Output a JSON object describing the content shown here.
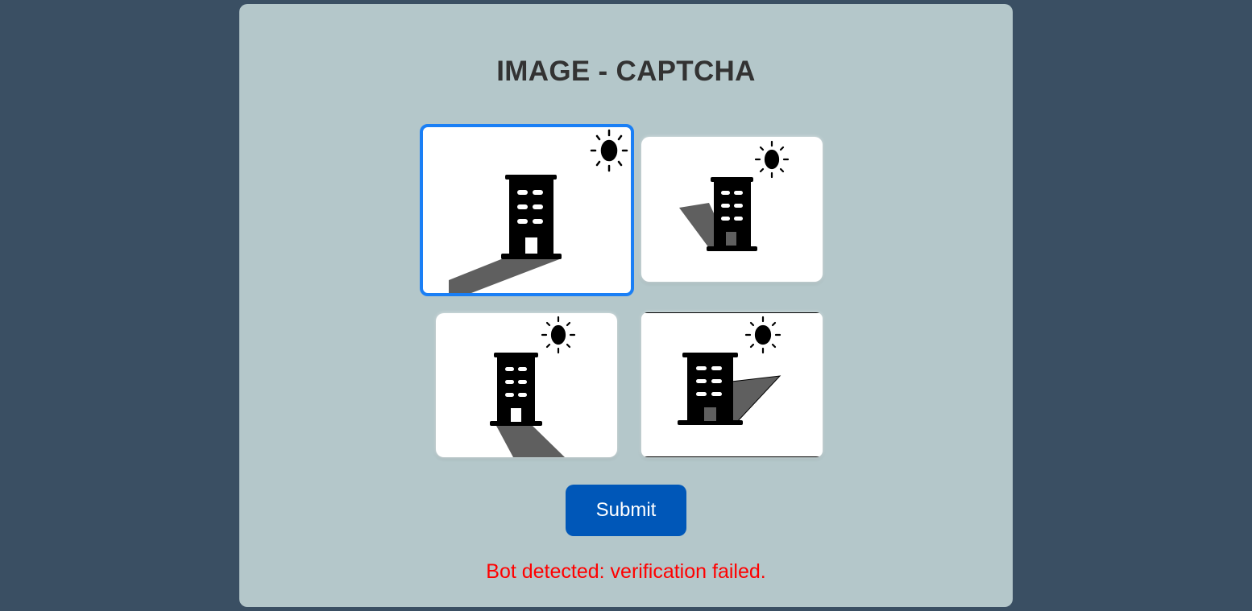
{
  "page": {
    "title": "IMAGE - CAPTCHA"
  },
  "captcha": {
    "tiles": [
      {
        "name": "building-shadow-image-1",
        "selected": true
      },
      {
        "name": "building-shadow-image-2",
        "selected": false
      },
      {
        "name": "building-shadow-image-3",
        "selected": false
      },
      {
        "name": "building-shadow-image-4",
        "selected": false
      }
    ],
    "selected_border_color": "#1a7ff5"
  },
  "actions": {
    "submit_label": "Submit"
  },
  "status": {
    "message": "Bot detected: verification failed.",
    "color": "#ff0000"
  },
  "colors": {
    "background": "#3a4f63",
    "card": "#b4c7ca",
    "button": "#0057b8"
  }
}
